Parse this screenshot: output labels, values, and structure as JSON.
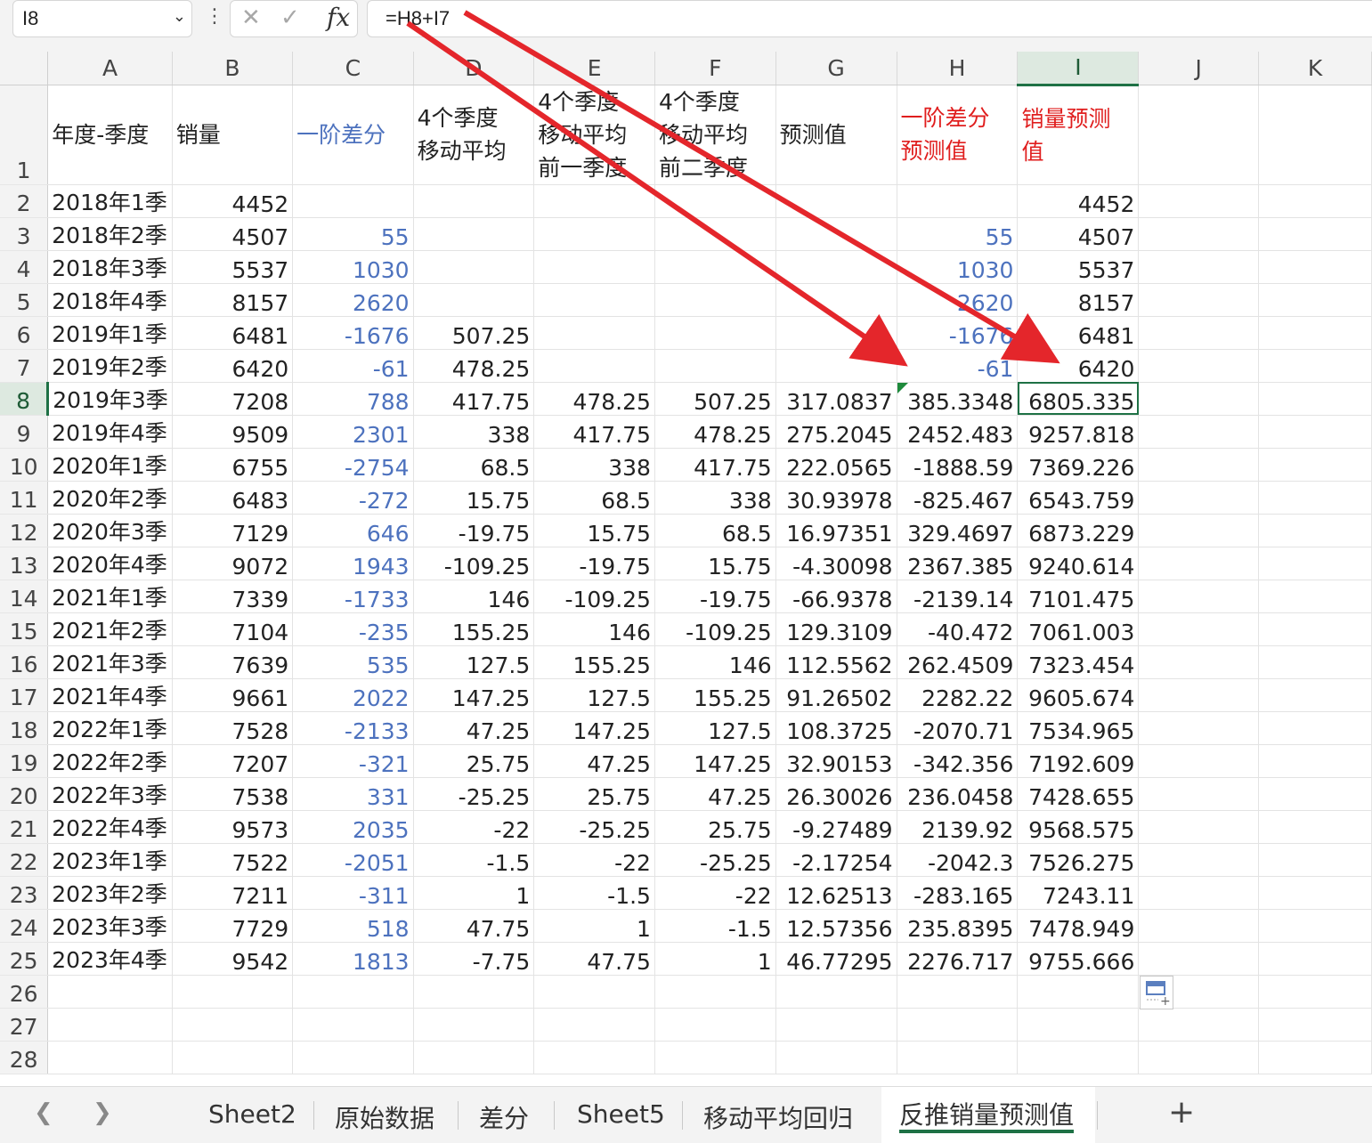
{
  "formula_bar": {
    "name_box": "I8",
    "formula": "=H8+I7",
    "fx_label": "fx"
  },
  "columns": [
    "A",
    "B",
    "C",
    "D",
    "E",
    "F",
    "G",
    "H",
    "I",
    "J",
    "K"
  ],
  "header_row": {
    "row_num": "1",
    "A": "年度-季度",
    "B": "销量",
    "C": "一阶差分",
    "D": [
      "4个季度",
      "移动平均"
    ],
    "E": [
      "4个季度",
      "移动平均",
      "前一季度"
    ],
    "F": [
      "4个季度",
      "移动平均",
      "前二季度"
    ],
    "G": "预测值",
    "H": [
      "一阶差分",
      "预测值"
    ],
    "I": [
      "销量预测",
      "值"
    ]
  },
  "rows": [
    {
      "r": "2",
      "A": "2018年1季",
      "B": "4452",
      "C": "",
      "D": "",
      "E": "",
      "F": "",
      "G": "",
      "H": "",
      "I": "4452"
    },
    {
      "r": "3",
      "A": "2018年2季",
      "B": "4507",
      "C": "55",
      "D": "",
      "E": "",
      "F": "",
      "G": "",
      "H": "55",
      "I": "4507"
    },
    {
      "r": "4",
      "A": "2018年3季",
      "B": "5537",
      "C": "1030",
      "D": "",
      "E": "",
      "F": "",
      "G": "",
      "H": "1030",
      "I": "5537"
    },
    {
      "r": "5",
      "A": "2018年4季",
      "B": "8157",
      "C": "2620",
      "D": "",
      "E": "",
      "F": "",
      "G": "",
      "H": "2620",
      "I": "8157"
    },
    {
      "r": "6",
      "A": "2019年1季",
      "B": "6481",
      "C": "-1676",
      "D": "507.25",
      "E": "",
      "F": "",
      "G": "",
      "H": "-1676",
      "I": "6481"
    },
    {
      "r": "7",
      "A": "2019年2季",
      "B": "6420",
      "C": "-61",
      "D": "478.25",
      "E": "",
      "F": "",
      "G": "",
      "H": "-61",
      "I": "6420"
    },
    {
      "r": "8",
      "A": "2019年3季",
      "B": "7208",
      "C": "788",
      "D": "417.75",
      "E": "478.25",
      "F": "507.25",
      "G": "317.0837",
      "H": "385.3348",
      "I": "6805.335"
    },
    {
      "r": "9",
      "A": "2019年4季",
      "B": "9509",
      "C": "2301",
      "D": "338",
      "E": "417.75",
      "F": "478.25",
      "G": "275.2045",
      "H": "2452.483",
      "I": "9257.818"
    },
    {
      "r": "10",
      "A": "2020年1季",
      "B": "6755",
      "C": "-2754",
      "D": "68.5",
      "E": "338",
      "F": "417.75",
      "G": "222.0565",
      "H": "-1888.59",
      "I": "7369.226"
    },
    {
      "r": "11",
      "A": "2020年2季",
      "B": "6483",
      "C": "-272",
      "D": "15.75",
      "E": "68.5",
      "F": "338",
      "G": "30.93978",
      "H": "-825.467",
      "I": "6543.759"
    },
    {
      "r": "12",
      "A": "2020年3季",
      "B": "7129",
      "C": "646",
      "D": "-19.75",
      "E": "15.75",
      "F": "68.5",
      "G": "16.97351",
      "H": "329.4697",
      "I": "6873.229"
    },
    {
      "r": "13",
      "A": "2020年4季",
      "B": "9072",
      "C": "1943",
      "D": "-109.25",
      "E": "-19.75",
      "F": "15.75",
      "G": "-4.30098",
      "H": "2367.385",
      "I": "9240.614"
    },
    {
      "r": "14",
      "A": "2021年1季",
      "B": "7339",
      "C": "-1733",
      "D": "146",
      "E": "-109.25",
      "F": "-19.75",
      "G": "-66.9378",
      "H": "-2139.14",
      "I": "7101.475"
    },
    {
      "r": "15",
      "A": "2021年2季",
      "B": "7104",
      "C": "-235",
      "D": "155.25",
      "E": "146",
      "F": "-109.25",
      "G": "129.3109",
      "H": "-40.472",
      "I": "7061.003"
    },
    {
      "r": "16",
      "A": "2021年3季",
      "B": "7639",
      "C": "535",
      "D": "127.5",
      "E": "155.25",
      "F": "146",
      "G": "112.5562",
      "H": "262.4509",
      "I": "7323.454"
    },
    {
      "r": "17",
      "A": "2021年4季",
      "B": "9661",
      "C": "2022",
      "D": "147.25",
      "E": "127.5",
      "F": "155.25",
      "G": "91.26502",
      "H": "2282.22",
      "I": "9605.674"
    },
    {
      "r": "18",
      "A": "2022年1季",
      "B": "7528",
      "C": "-2133",
      "D": "47.25",
      "E": "147.25",
      "F": "127.5",
      "G": "108.3725",
      "H": "-2070.71",
      "I": "7534.965"
    },
    {
      "r": "19",
      "A": "2022年2季",
      "B": "7207",
      "C": "-321",
      "D": "25.75",
      "E": "47.25",
      "F": "147.25",
      "G": "32.90153",
      "H": "-342.356",
      "I": "7192.609"
    },
    {
      "r": "20",
      "A": "2022年3季",
      "B": "7538",
      "C": "331",
      "D": "-25.25",
      "E": "25.75",
      "F": "47.25",
      "G": "26.30026",
      "H": "236.0458",
      "I": "7428.655"
    },
    {
      "r": "21",
      "A": "2022年4季",
      "B": "9573",
      "C": "2035",
      "D": "-22",
      "E": "-25.25",
      "F": "25.75",
      "G": "-9.27489",
      "H": "2139.92",
      "I": "9568.575"
    },
    {
      "r": "22",
      "A": "2023年1季",
      "B": "7522",
      "C": "-2051",
      "D": "-1.5",
      "E": "-22",
      "F": "-25.25",
      "G": "-2.17254",
      "H": "-2042.3",
      "I": "7526.275"
    },
    {
      "r": "23",
      "A": "2023年2季",
      "B": "7211",
      "C": "-311",
      "D": "1",
      "E": "-1.5",
      "F": "-22",
      "G": "12.62513",
      "H": "-283.165",
      "I": "7243.11"
    },
    {
      "r": "24",
      "A": "2023年3季",
      "B": "7729",
      "C": "518",
      "D": "47.75",
      "E": "1",
      "F": "-1.5",
      "G": "12.57356",
      "H": "235.8395",
      "I": "7478.949"
    },
    {
      "r": "25",
      "A": "2023年4季",
      "B": "9542",
      "C": "1813",
      "D": "-7.75",
      "E": "47.75",
      "F": "1",
      "G": "46.77295",
      "H": "2276.717",
      "I": "9755.666"
    },
    {
      "r": "26",
      "A": "",
      "B": "",
      "C": "",
      "D": "",
      "E": "",
      "F": "",
      "G": "",
      "H": "",
      "I": ""
    },
    {
      "r": "27",
      "A": "",
      "B": "",
      "C": "",
      "D": "",
      "E": "",
      "F": "",
      "G": "",
      "H": "",
      "I": ""
    },
    {
      "r": "28",
      "A": "",
      "B": "",
      "C": "",
      "D": "",
      "E": "",
      "F": "",
      "G": "",
      "H": "",
      "I": ""
    }
  ],
  "sheet_tabs": [
    "Sheet2",
    "原始数据",
    "差分",
    "Sheet5",
    "移动平均回归",
    "反推销量预测值"
  ],
  "active_tab": "反推销量预测值",
  "colors": {
    "accent_green": "#1e7145",
    "blue_text": "#4d72be",
    "red_text": "#e01e1e",
    "arrow_red": "#e4262b"
  }
}
